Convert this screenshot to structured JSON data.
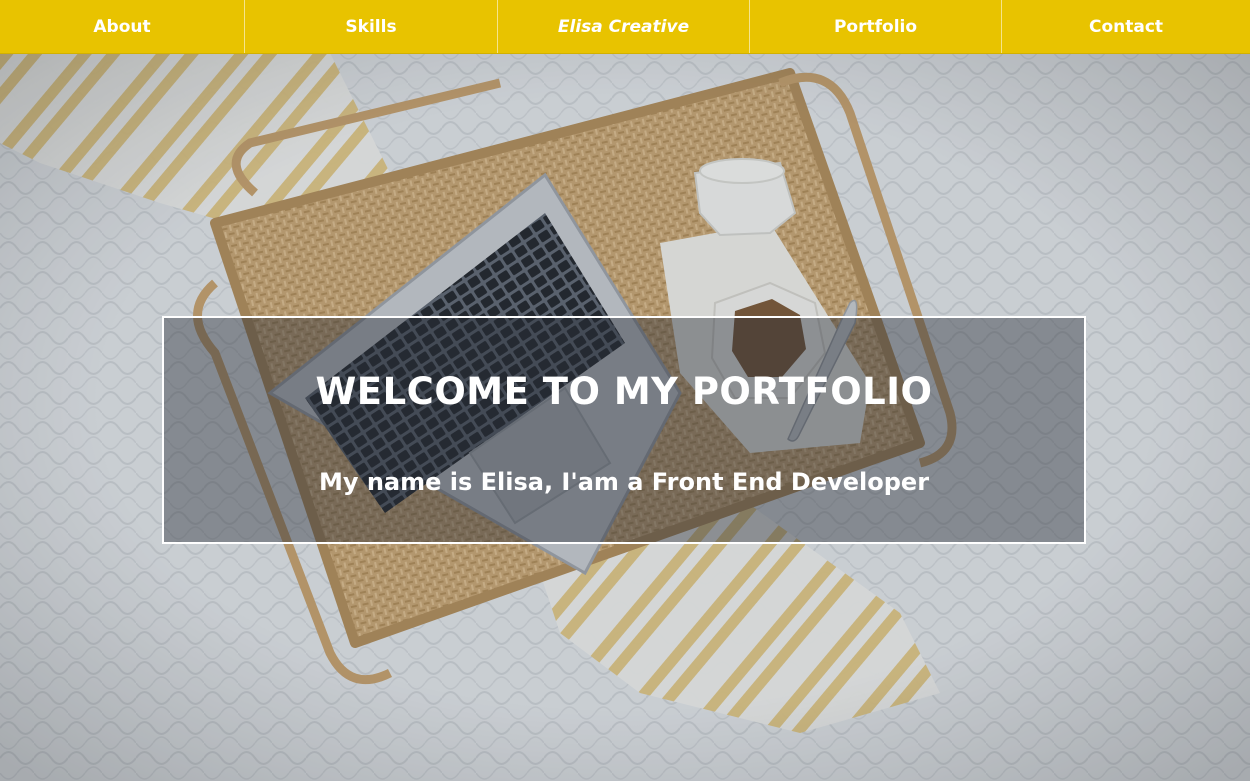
{
  "nav": {
    "items": [
      {
        "label": "About"
      },
      {
        "label": "Skills"
      },
      {
        "label": "Elisa Creative"
      },
      {
        "label": "Portfolio"
      },
      {
        "label": "Contact"
      }
    ]
  },
  "hero": {
    "title": "WELCOME TO MY PORTFOLIO",
    "subtitle": "My name is Elisa, I'am a Front End Developer"
  },
  "colors": {
    "nav_background": "#e8c300",
    "nav_text": "#ffffff",
    "hero_text": "#ffffff"
  }
}
